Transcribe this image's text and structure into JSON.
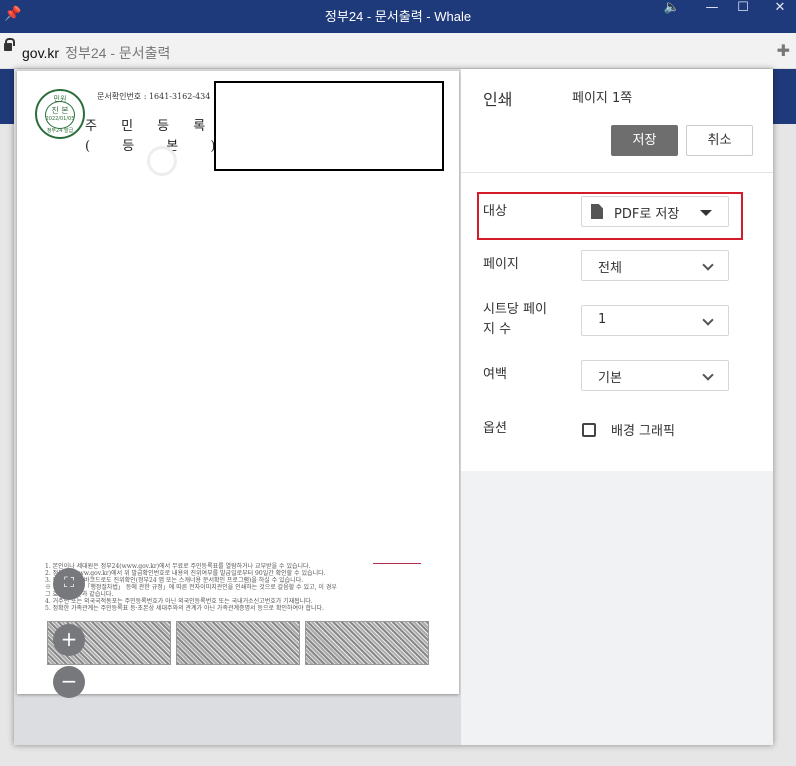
{
  "window": {
    "title": "정부24 - 문서출력 - Whale"
  },
  "addressbar": {
    "host": "gov.kr",
    "page_title": "정부24 - 문서출력"
  },
  "document": {
    "seal_lines": [
      "민원",
      "진 본",
      "2022/01/05",
      "정부24 발급"
    ],
    "doc_number": "문서확인번호 : 1641-3162-434",
    "title_line1": "주 민 등 록 표",
    "title_line2": "( 등   본 )",
    "notes": [
      "1. 본인이나 세대원은 정부24(www.gov.kr)에서 무료로 주민등록표를 열람하거나 교부받을 수 있습니다.",
      "2. 정부24(www.gov.kr)에서 위 발급확인번호로 내용의 진위여부를 발급일로부터 90일간 확인할 수 있습니다.",
      "3. 문서 하단의 바코드로도 진위확인(정부24 앱 또는 스캐너용 문서확인 프로그램)을 하실 수 있습니다.",
      "   ※ 본 증명서는 「행정절차법」 등에 관한 규정」에 따른 전자이미지관인을 인쇄하는 것으로 갈음할 수 있고, 이 경우",
      "   그 효력은 원본과 같습니다.",
      "4. 거주민 또는 외국국적동포는 주민등록번호가 아닌 외국인등록번호 또는 국내거소신고번호가 기재됩니다.",
      "5. 정확한 가족관계는 주민등록표 등·초본상 세대주와의 관계가 아닌 가족관계증명서 등으로 확인하여야 합니다."
    ]
  },
  "zoom": {
    "fit_icon": "fit-to-page-icon",
    "in_label": "+",
    "out_label": "−"
  },
  "print": {
    "title": "인쇄",
    "page_count": "페이지 1쪽",
    "save_label": "저장",
    "cancel_label": "취소",
    "destination_label": "대상",
    "destination_value": "PDF로 저장",
    "pages_label": "페이지",
    "pages_value": "전체",
    "pps_label_line1": "시트당 페이",
    "pps_label_line2": "지 수",
    "pps_value": "1",
    "margins_label": "여백",
    "margins_value": "기본",
    "options_label": "옵션",
    "bg_graphics_label": "배경 그래픽",
    "bg_graphics_checked": false
  },
  "colors": {
    "titlebar": "#1f3a7a",
    "highlight": "#d31b2c",
    "save_button": "#6e6e6e"
  }
}
